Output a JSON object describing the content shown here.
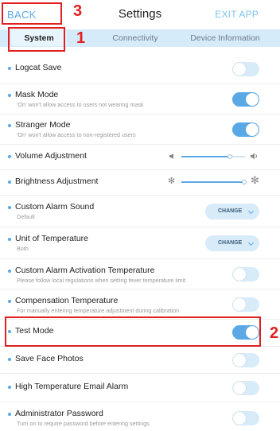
{
  "header": {
    "back_label": "BACK",
    "title": "Settings",
    "exit_label": "EXIT APP"
  },
  "annotations": {
    "n1": "1",
    "n2": "2",
    "n3": "3"
  },
  "tabs": [
    {
      "label": "System",
      "active": true
    },
    {
      "label": "Connectivity",
      "active": false
    },
    {
      "label": "Device Information",
      "active": false
    }
  ],
  "settings": {
    "logcat": {
      "label": "Logcat Save",
      "enabled": false
    },
    "mask": {
      "label": "Mask Mode",
      "sub": "'On' won't allow access to users not wearing mask",
      "enabled": true
    },
    "stranger": {
      "label": "Stranger Mode",
      "sub": "'On' won't allow access to non-registered users",
      "enabled": true
    },
    "volume": {
      "label": "Volume Adjustment",
      "level": 0.8
    },
    "brightness": {
      "label": "Brightness Adjustment",
      "level": 1.0
    },
    "alarm_sound": {
      "label": "Custom Alarm Sound",
      "sub": "Default",
      "button": "CHANGE"
    },
    "temp_unit": {
      "label": "Unit of Temperature",
      "sub": "Both",
      "button": "CHANGE"
    },
    "alarm_temp": {
      "label": "Custom Alarm Activation Temperature",
      "sub": "Please follow local regulations when setting fever temperature limit",
      "enabled": false
    },
    "compensation": {
      "label": "Compensation Temperature",
      "sub": "For manually entering temperature adjustment during calibration",
      "enabled": false
    },
    "test_mode": {
      "label": "Test Mode",
      "enabled": true
    },
    "face_photos": {
      "label": "Save Face Photos",
      "enabled": false
    },
    "email_alarm": {
      "label": "High Temperature Email Alarm",
      "enabled": false
    },
    "admin_password": {
      "label": "Administrator Password",
      "sub": "Turn on to require password before entering settings",
      "enabled": false
    }
  },
  "colors": {
    "accent": "#5aa9e6",
    "toggle_off": "#d7ebf9",
    "annotation": "#e02020"
  },
  "icons": {
    "volume_low": "speaker-low-icon",
    "volume_high": "speaker-high-icon",
    "brightness_low": "sun-small-icon",
    "brightness_high": "sun-large-icon"
  }
}
